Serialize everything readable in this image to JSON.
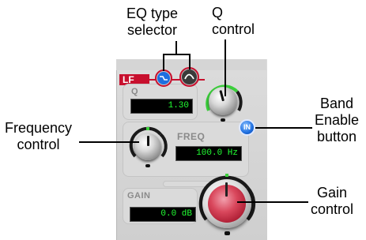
{
  "callouts": {
    "eq_type_selector": [
      "EQ type",
      "selector"
    ],
    "q_control": [
      "Q",
      "control"
    ],
    "frequency_control": [
      "Frequency",
      "control"
    ],
    "band_enable_button": [
      "Band",
      "Enable",
      "button"
    ],
    "gain_control": [
      "Gain",
      "control"
    ]
  },
  "plugin": {
    "band_label": "LF",
    "q": {
      "label": "Q",
      "value": "1.30"
    },
    "freq": {
      "label": "FREQ",
      "value": "100.0 Hz"
    },
    "gain": {
      "label": "GAIN",
      "value": "0.0 dB"
    },
    "band_enable_label": "IN"
  },
  "colors": {
    "band_red": "#c8102e",
    "lcd_green": "#22ff33",
    "enable_blue": "#1e6fe0",
    "gain_knob_red": "#d9475c"
  }
}
